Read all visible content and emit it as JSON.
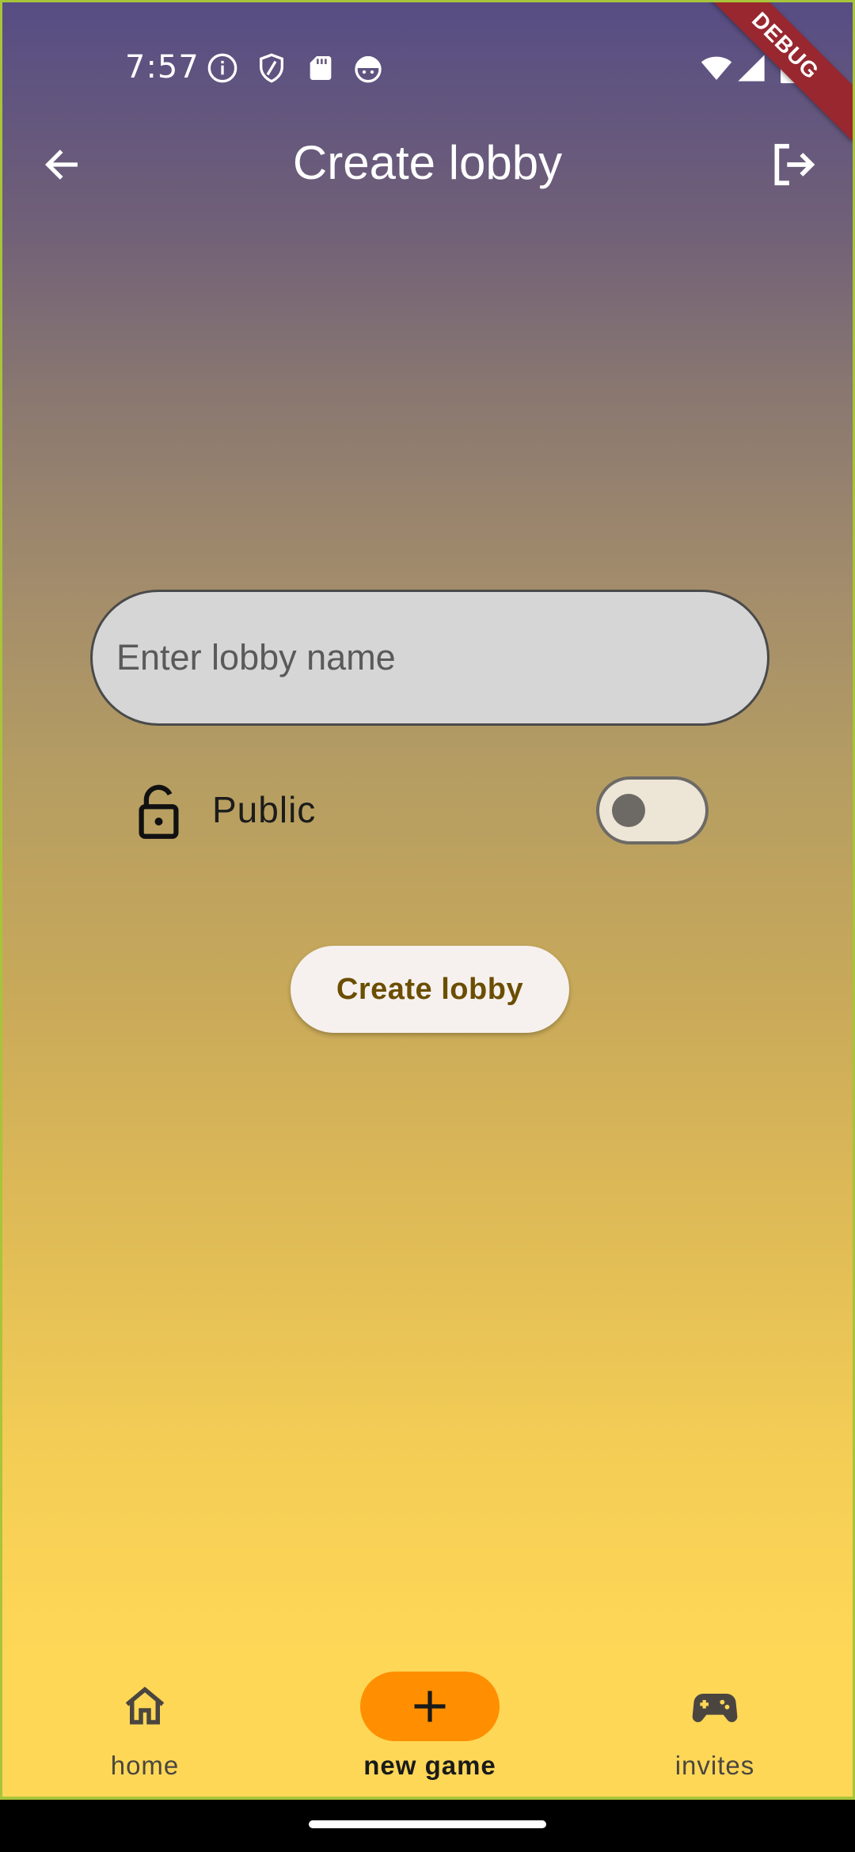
{
  "status_bar": {
    "time": "7:57",
    "left_icons": [
      "info-icon",
      "shield-icon",
      "sd-card-icon",
      "android-face-icon"
    ],
    "right_icons": [
      "wifi-icon",
      "cell-signal-icon",
      "battery-icon"
    ]
  },
  "debug_banner": "DEBUG",
  "app_bar": {
    "title": "Create lobby"
  },
  "form": {
    "lobby_name_placeholder": "Enter lobby name",
    "lobby_name_value": "",
    "public_label": "Public",
    "public_enabled": false,
    "create_button_label": "Create lobby"
  },
  "bottom_nav": {
    "items": [
      {
        "label": "home",
        "icon": "home-icon",
        "active": false
      },
      {
        "label": "new game",
        "icon": "plus-icon",
        "active": true
      },
      {
        "label": "invites",
        "icon": "gamepad-icon",
        "active": false
      }
    ]
  },
  "colors": {
    "gradient_top": "#574d84",
    "gradient_bottom": "#ffd757",
    "nav_active_pill": "#ff8f00",
    "create_button_text": "#6b4e00",
    "debug_banner": "#98272f"
  }
}
